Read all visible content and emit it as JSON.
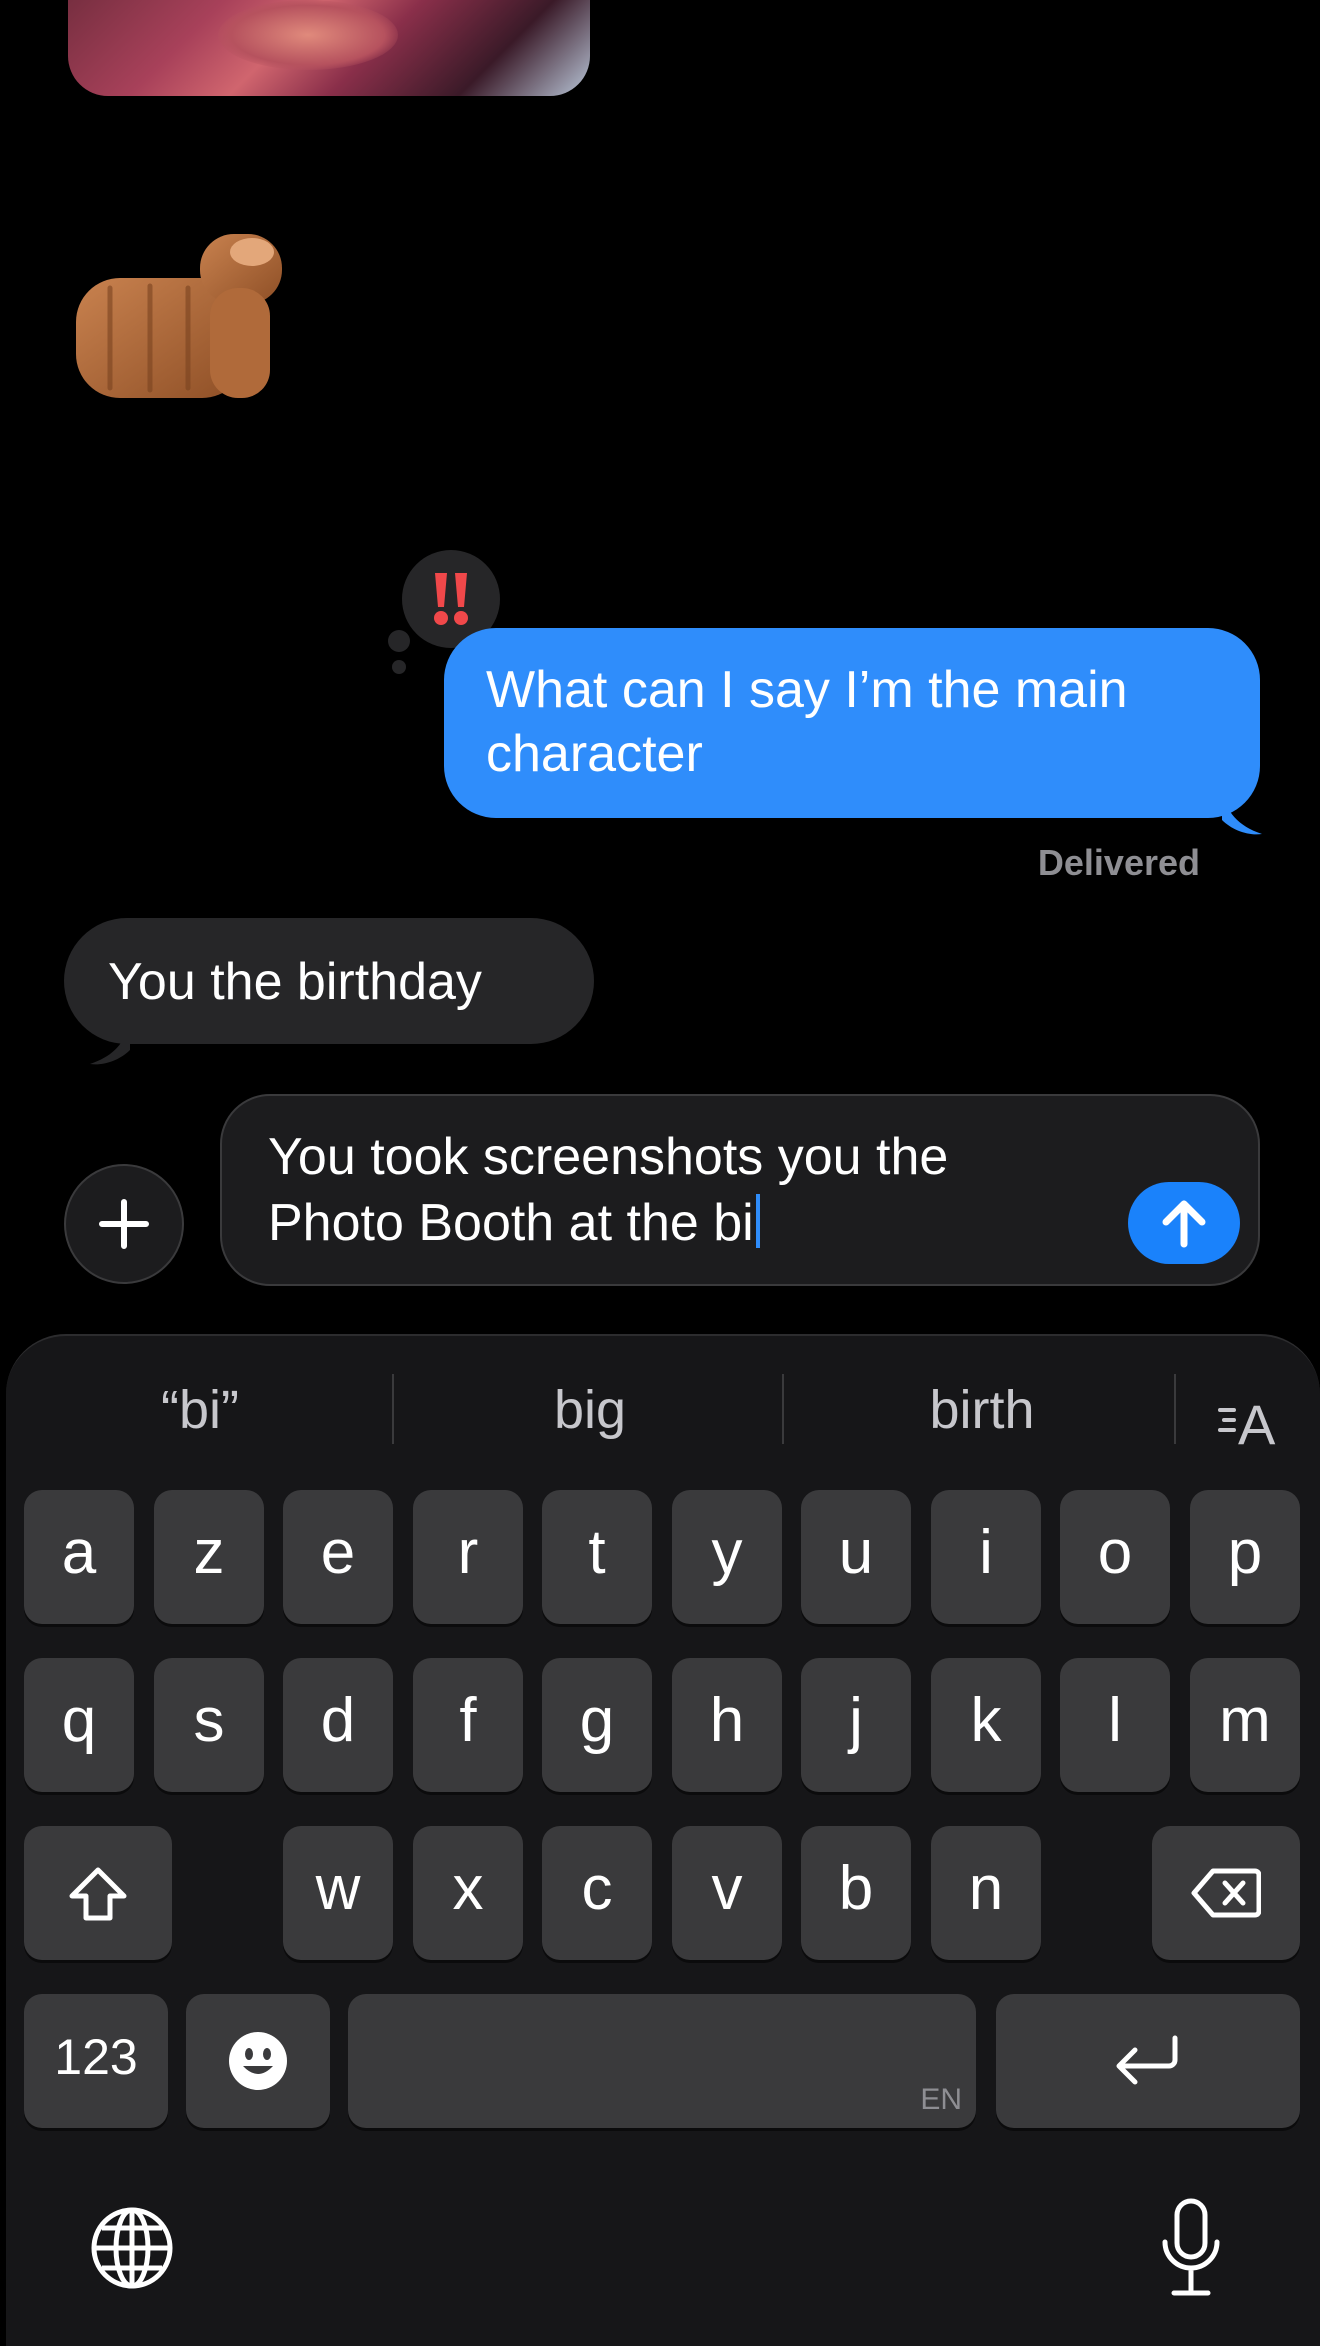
{
  "conversation": {
    "sent_message": "What can I say I’m the main character",
    "sent_status": "Delivered",
    "tapback_emoji": "‼️",
    "received_message": "You the birthday",
    "sticker_emoji": "👉🏽"
  },
  "composer": {
    "text": "You took screenshots you the Photo Booth at the bi",
    "plus_icon": "plus-icon",
    "send_icon": "arrow-up-icon"
  },
  "keyboard": {
    "suggestions": [
      "“bi”",
      "big",
      "birth"
    ],
    "format_label": "A",
    "row1": [
      "a",
      "z",
      "e",
      "r",
      "t",
      "y",
      "u",
      "i",
      "o",
      "p"
    ],
    "row2": [
      "q",
      "s",
      "d",
      "f",
      "g",
      "h",
      "j",
      "k",
      "l",
      "m"
    ],
    "row3": [
      "w",
      "x",
      "c",
      "v",
      "b",
      "n"
    ],
    "numbers_label": "123",
    "space_lang": "EN",
    "colors": {
      "accent": "#2f8dfb",
      "key": "#3a3a3c",
      "keyboard_bg": "#161618"
    }
  }
}
